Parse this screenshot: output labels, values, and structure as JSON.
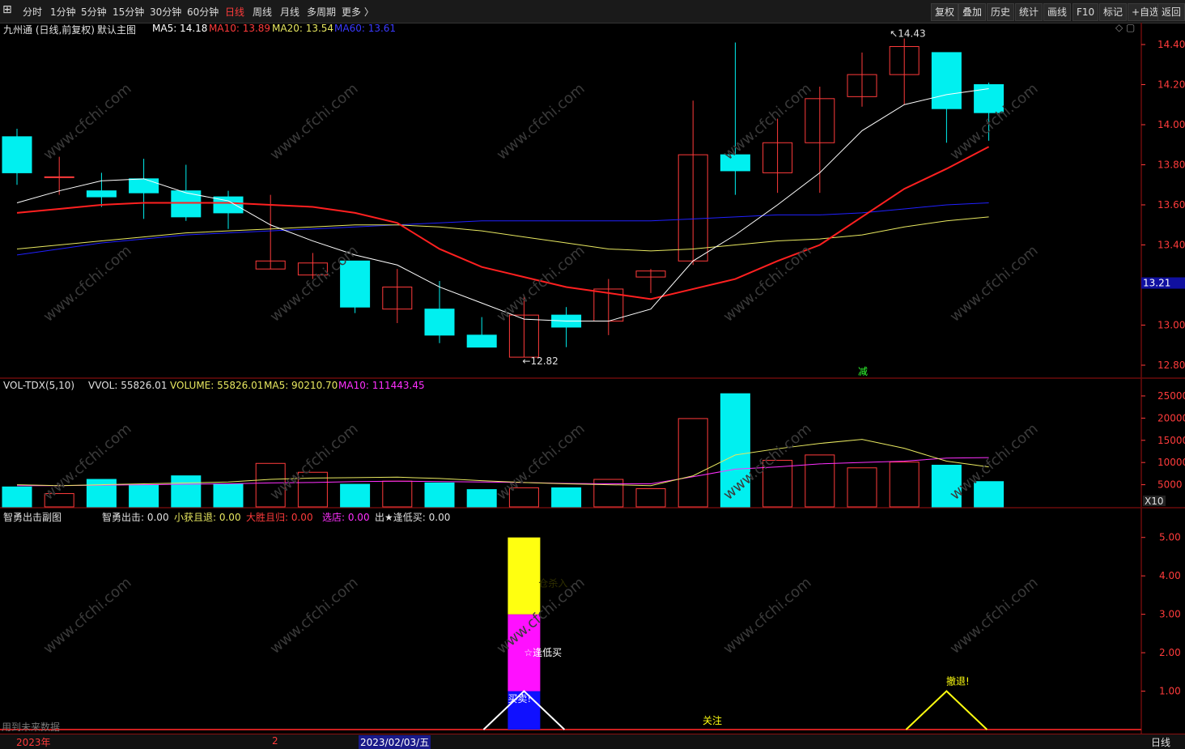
{
  "toolbar": {
    "back_icon": "back-arrow-icon",
    "periods": [
      "分时",
      "1分钟",
      "5分钟",
      "15分钟",
      "30分钟",
      "60分钟",
      "日线",
      "周线",
      "月线",
      "多周期",
      "更多 〉"
    ],
    "active_period": "日线",
    "right_buttons": [
      "复权",
      "叠加",
      "历史",
      "统计",
      "画线",
      "F10",
      "标记",
      "+自选",
      "返回"
    ]
  },
  "main_header": {
    "stock": "九州通 (日线,前复权)",
    "chart_name": "默认主图",
    "ma5": "MA5: 14.18",
    "ma10": "MA10: 13.89",
    "ma20": "MA20: 13.54",
    "ma60": "MA60: 13.61"
  },
  "colors": {
    "up": "#ff3b3b",
    "down": "#00f0f0",
    "ma5": "#ffffff",
    "ma10": "#ff2020",
    "ma20": "#e8e860",
    "ma60": "#2020ff",
    "grid": "#6a0a0a"
  },
  "main_axis": [
    "14.40",
    "14.20",
    "14.00",
    "13.80",
    "13.60",
    "13.40",
    "13.20",
    "13.00",
    "12.80"
  ],
  "current_price": "13.21",
  "high_mark": "14.43",
  "low_mark": "12.82",
  "mark_text": "减",
  "chart_data": {
    "type": "candlestick",
    "candles": [
      {
        "o": 13.94,
        "h": 13.98,
        "l": 13.7,
        "c": 13.76
      },
      {
        "o": 13.74,
        "h": 13.84,
        "l": 13.65,
        "c": 13.74
      },
      {
        "o": 13.67,
        "h": 13.76,
        "l": 13.59,
        "c": 13.64
      },
      {
        "o": 13.73,
        "h": 13.83,
        "l": 13.53,
        "c": 13.66
      },
      {
        "o": 13.67,
        "h": 13.8,
        "l": 13.52,
        "c": 13.54
      },
      {
        "o": 13.64,
        "h": 13.67,
        "l": 13.48,
        "c": 13.56
      },
      {
        "o": 13.28,
        "h": 13.65,
        "l": 13.28,
        "c": 13.32
      },
      {
        "o": 13.25,
        "h": 13.36,
        "l": 13.23,
        "c": 13.31
      },
      {
        "o": 13.32,
        "h": 13.32,
        "l": 13.06,
        "c": 13.09
      },
      {
        "o": 13.08,
        "h": 13.28,
        "l": 13.01,
        "c": 13.19
      },
      {
        "o": 13.08,
        "h": 13.22,
        "l": 12.91,
        "c": 12.95
      },
      {
        "o": 12.95,
        "h": 13.04,
        "l": 12.89,
        "c": 12.89
      },
      {
        "o": 12.84,
        "h": 13.15,
        "l": 12.84,
        "c": 13.05
      },
      {
        "o": 13.05,
        "h": 13.09,
        "l": 12.89,
        "c": 12.99
      },
      {
        "o": 13.02,
        "h": 13.23,
        "l": 12.95,
        "c": 13.18
      },
      {
        "o": 13.24,
        "h": 13.28,
        "l": 13.16,
        "c": 13.27
      },
      {
        "o": 13.32,
        "h": 14.12,
        "l": 13.3,
        "c": 13.85
      },
      {
        "o": 13.85,
        "h": 14.41,
        "l": 13.65,
        "c": 13.77
      },
      {
        "o": 13.76,
        "h": 14.03,
        "l": 13.66,
        "c": 13.91
      },
      {
        "o": 13.91,
        "h": 14.19,
        "l": 13.66,
        "c": 14.13
      },
      {
        "o": 14.14,
        "h": 14.36,
        "l": 14.09,
        "c": 14.25
      },
      {
        "o": 14.25,
        "h": 14.43,
        "l": 14.1,
        "c": 14.39
      },
      {
        "o": 14.36,
        "h": 14.36,
        "l": 13.91,
        "c": 14.08
      },
      {
        "o": 14.2,
        "h": 14.21,
        "l": 13.92,
        "c": 14.06
      }
    ],
    "ma5": [
      13.61,
      13.67,
      13.72,
      13.73,
      13.66,
      13.62,
      13.5,
      13.42,
      13.35,
      13.3,
      13.19,
      13.11,
      13.03,
      13.02,
      13.02,
      13.08,
      13.32,
      13.45,
      13.6,
      13.76,
      13.97,
      14.1,
      14.15,
      14.18
    ],
    "ma10": [
      13.56,
      13.58,
      13.6,
      13.61,
      13.61,
      13.61,
      13.6,
      13.59,
      13.56,
      13.51,
      13.38,
      13.29,
      13.24,
      13.19,
      13.16,
      13.13,
      13.18,
      13.23,
      13.32,
      13.4,
      13.54,
      13.68,
      13.78,
      13.89
    ],
    "ma20": [
      13.38,
      13.4,
      13.42,
      13.44,
      13.46,
      13.47,
      13.48,
      13.49,
      13.5,
      13.5,
      13.49,
      13.47,
      13.44,
      13.41,
      13.38,
      13.37,
      13.38,
      13.4,
      13.42,
      13.43,
      13.45,
      13.49,
      13.52,
      13.54
    ],
    "ma60": [
      13.35,
      13.38,
      13.41,
      13.43,
      13.45,
      13.46,
      13.47,
      13.48,
      13.49,
      13.5,
      13.51,
      13.52,
      13.52,
      13.52,
      13.52,
      13.52,
      13.53,
      13.54,
      13.55,
      13.55,
      13.56,
      13.58,
      13.6,
      13.61
    ]
  },
  "vol_header": {
    "name": "VOL-TDX(5,10)",
    "vvol": "VVOL: 55826.01",
    "volume": "VOLUME: 55826.01",
    "ma5": "MA5: 90210.70",
    "ma10": "MA10: 111443.45"
  },
  "vol_axis": [
    "25000",
    "20000",
    "15000",
    "10000",
    "5000"
  ],
  "vol_unit": "X10",
  "vol_data": {
    "values": [
      4500,
      3000,
      6200,
      5000,
      7000,
      5200,
      9800,
      7800,
      5100,
      5800,
      5400,
      3900,
      4300,
      4300,
      6200,
      4100,
      19900,
      25500,
      10500,
      11700,
      8800,
      10100,
      9400,
      5700
    ],
    "ma5": [
      5000,
      4800,
      5000,
      5200,
      5400,
      5600,
      6200,
      6500,
      6600,
      6700,
      6400,
      5900,
      5500,
      5200,
      5000,
      4800,
      7000,
      11700,
      13100,
      14300,
      15200,
      13200,
      10300,
      9000
    ],
    "ma10": [
      4800,
      4800,
      4900,
      5000,
      5100,
      5200,
      5400,
      5500,
      5700,
      5800,
      5700,
      5600,
      5500,
      5300,
      5200,
      5200,
      6800,
      8500,
      9000,
      9700,
      10000,
      10300,
      11000,
      11100
    ]
  },
  "sub_header": {
    "name": "智勇出击副图",
    "zy": "智勇出击: 0.00",
    "xhqt": "小获且退: 0.00",
    "dsqg": "大胜且归: 0.00",
    "xc": "选店: 0.00",
    "fdm": "出★逢低买: 0.00"
  },
  "sub_axis": [
    "5.00",
    "4.00",
    "3.00",
    "2.00",
    "1.00"
  ],
  "sub_labels": {
    "cang": "仓杀入",
    "fengdi": "☆逢低买",
    "mailai": "买卖!",
    "guanzhu": "关注",
    "chetui": "撤退!",
    "future": "用到未来数据"
  },
  "bottom": {
    "year": "2023年",
    "month": "2",
    "date": "2023/02/03/五",
    "right": "日线"
  },
  "watermark": "www.cfchi.com"
}
